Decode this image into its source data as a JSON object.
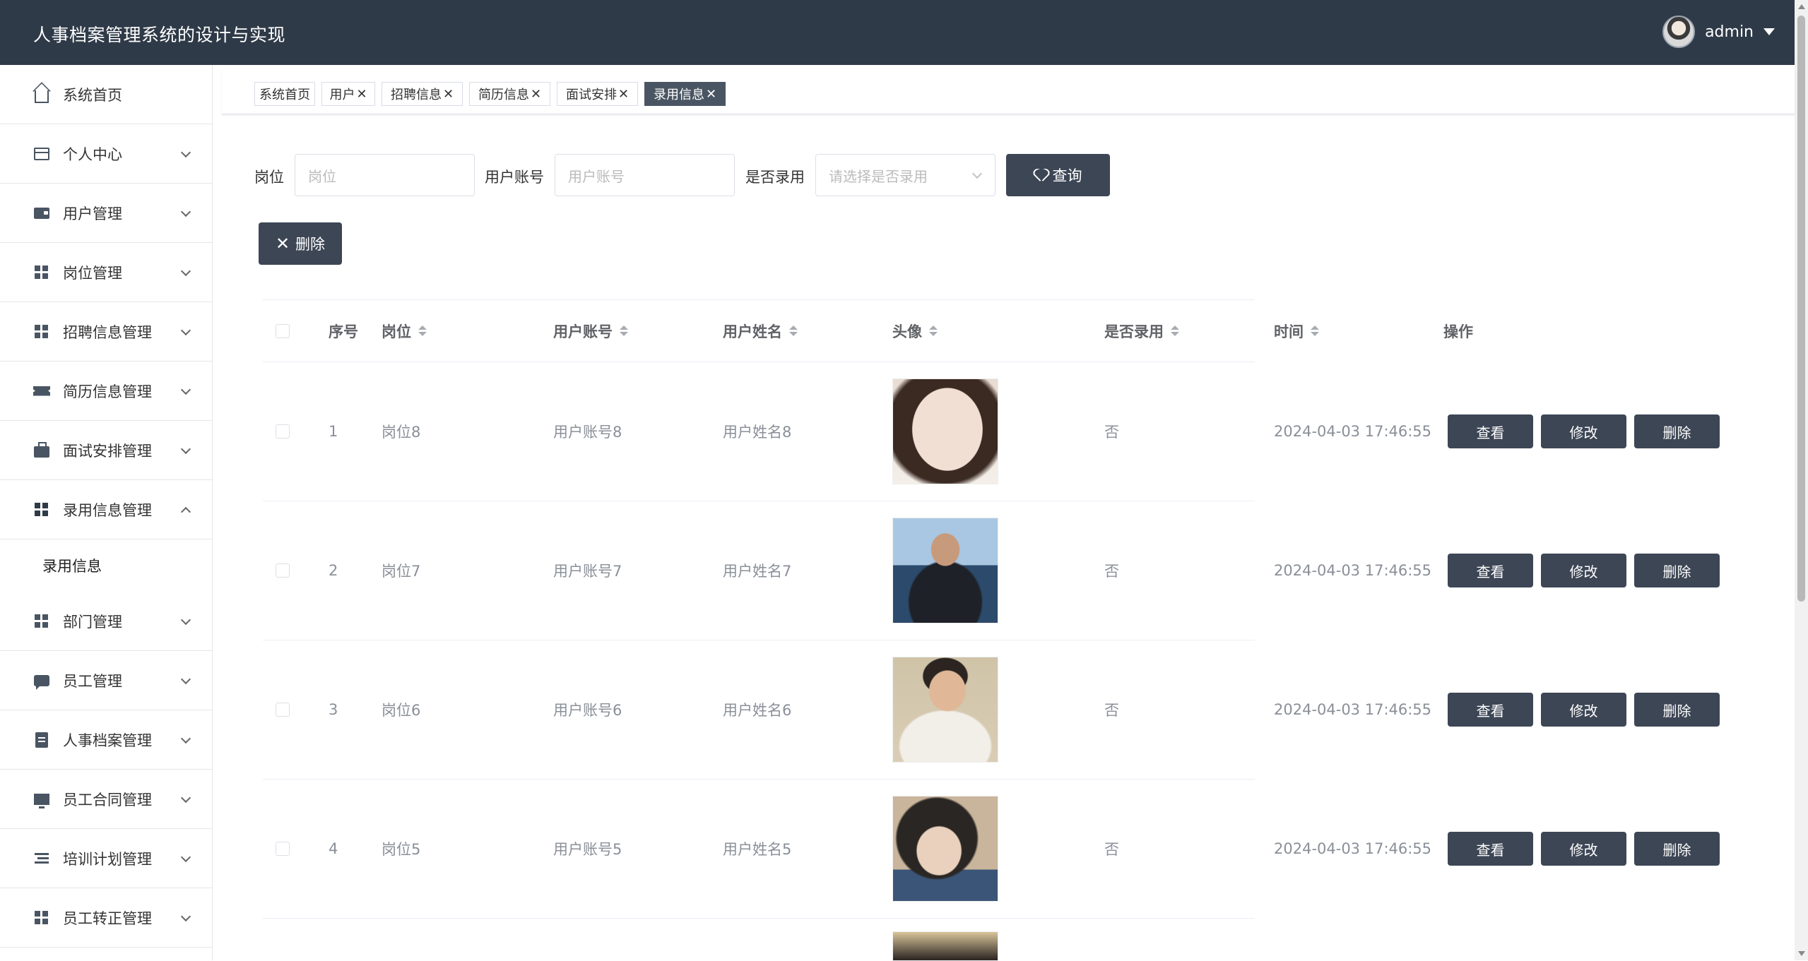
{
  "header": {
    "app_title": "人事档案管理系统的设计与实现",
    "username": "admin"
  },
  "sidebar": {
    "items": [
      {
        "label": "系统首页",
        "icon": "home-icon",
        "expandable": false
      },
      {
        "label": "个人中心",
        "icon": "card-icon",
        "expandable": true
      },
      {
        "label": "用户管理",
        "icon": "wallet-icon",
        "expandable": true
      },
      {
        "label": "岗位管理",
        "icon": "grid-icon",
        "expandable": true
      },
      {
        "label": "招聘信息管理",
        "icon": "grid-icon",
        "expandable": true
      },
      {
        "label": "简历信息管理",
        "icon": "ticket-icon",
        "expandable": true
      },
      {
        "label": "面试安排管理",
        "icon": "briefcase-icon",
        "expandable": true
      },
      {
        "label": "录用信息管理",
        "icon": "grid-icon",
        "expandable": true,
        "expanded": true
      },
      {
        "label": "部门管理",
        "icon": "grid-icon",
        "expandable": true
      },
      {
        "label": "员工管理",
        "icon": "chat-icon",
        "expandable": true
      },
      {
        "label": "人事档案管理",
        "icon": "clipboard-icon",
        "expandable": true
      },
      {
        "label": "员工合同管理",
        "icon": "monitor-icon",
        "expandable": true
      },
      {
        "label": "培训计划管理",
        "icon": "list-icon",
        "expandable": true
      },
      {
        "label": "员工转正管理",
        "icon": "grid-icon",
        "expandable": true
      }
    ],
    "sub_item": "录用信息"
  },
  "tags": [
    {
      "label": "系统首页",
      "closable": false
    },
    {
      "label": "用户",
      "closable": true
    },
    {
      "label": "招聘信息",
      "closable": true
    },
    {
      "label": "简历信息",
      "closable": true
    },
    {
      "label": "面试安排",
      "closable": true
    },
    {
      "label": "录用信息",
      "closable": true,
      "active": true
    }
  ],
  "tag_close": "✕",
  "search": {
    "post_label": "岗位",
    "post_placeholder": "岗位",
    "account_label": "用户账号",
    "account_placeholder": "用户账号",
    "hired_label": "是否录用",
    "hired_placeholder": "请选择是否录用",
    "query_button": "查询"
  },
  "delete_button": "删除",
  "table": {
    "columns": {
      "index": "序号",
      "post": "岗位",
      "account": "用户账号",
      "name": "用户姓名",
      "avatar": "头像",
      "hired": "是否录用",
      "time": "时间",
      "actions": "操作"
    },
    "actions": {
      "view": "查看",
      "edit": "修改",
      "delete": "删除"
    },
    "rows": [
      {
        "index": "1",
        "post": "岗位8",
        "account": "用户账号8",
        "name": "用户姓名8",
        "hired": "否",
        "time": "2024-04-03 17:46:55",
        "avatar_colors": [
          "#e9dcd2",
          "#3b2a22",
          "#f4efe9"
        ]
      },
      {
        "index": "2",
        "post": "岗位7",
        "account": "用户账号7",
        "name": "用户姓名7",
        "hired": "否",
        "time": "2024-04-03 17:46:55",
        "avatar_colors": [
          "#7fa6c8",
          "#1e2a3a",
          "#2c4a6b"
        ]
      },
      {
        "index": "3",
        "post": "岗位6",
        "account": "用户账号6",
        "name": "用户姓名6",
        "hired": "否",
        "time": "2024-04-03 17:46:55",
        "avatar_colors": [
          "#d9cdb5",
          "#2b2420",
          "#f2efe9"
        ]
      },
      {
        "index": "4",
        "post": "岗位5",
        "account": "用户账号5",
        "name": "用户姓名5",
        "hired": "否",
        "time": "2024-04-03 17:46:55",
        "avatar_colors": [
          "#c9b59c",
          "#2a2623",
          "#3b5578"
        ]
      }
    ]
  },
  "colors": {
    "header_bg": "#2f3a48",
    "button_bg": "#3d4655",
    "active_tag_bg": "#4a5563"
  }
}
